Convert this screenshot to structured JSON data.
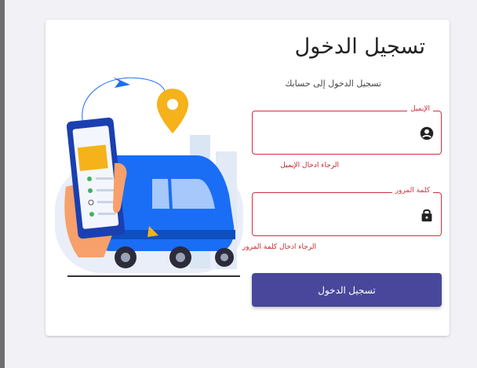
{
  "login": {
    "title": "تسجيل الدخول",
    "subtitle": "تسجيل الدخول إلى حسابك",
    "email": {
      "label": "الإيميل",
      "value": "",
      "error": "الرجاء ادخال الإيميل",
      "icon": "user-icon"
    },
    "password": {
      "label": "كلمة المرور",
      "value": "",
      "error": "الرجاء ادخال كلمة المرور",
      "icon": "lock-icon"
    },
    "submit_label": "تسجيل الدخول"
  },
  "colors": {
    "primary": "#48479b",
    "error": "#d32f3f",
    "truck": "#1a6ef5",
    "pin": "#f5b21a"
  },
  "illustration": "delivery-truck-with-phone-illustration"
}
